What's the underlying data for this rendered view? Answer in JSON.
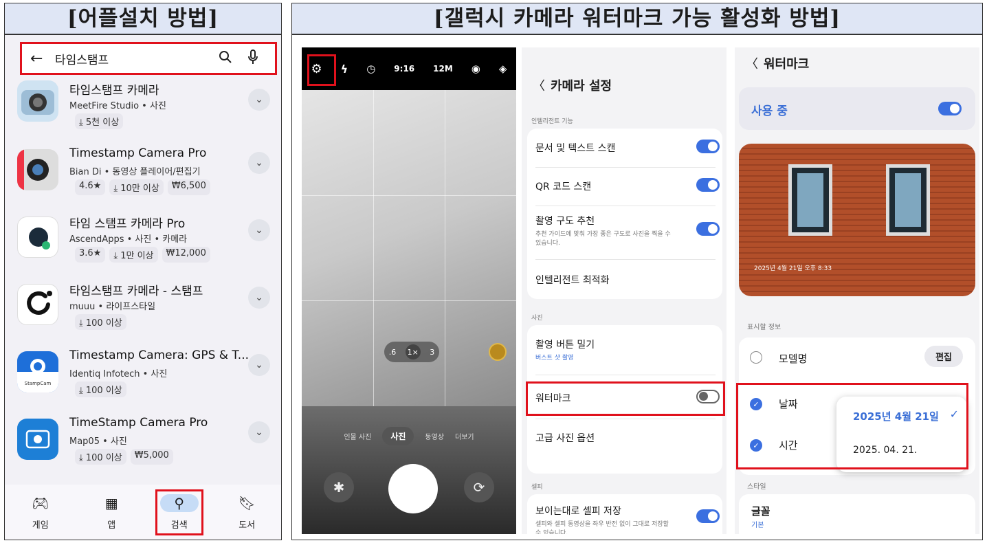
{
  "headers": {
    "left": "[어플설치 방법]",
    "right": "[갤럭시 카메라 워터마크 가능 활성화 방법]"
  },
  "store": {
    "search_query": "타임스탬프",
    "apps": [
      {
        "name": "타임스탬프 카메라",
        "dev": "MeetFire Studio • 사진",
        "badges": [
          "⤓ 5천 이상"
        ]
      },
      {
        "name": "Timestamp Camera Pro",
        "dev": "Bian Di • 동영상 플레이어/편집기",
        "badges": [
          "4.6★",
          "⤓ 10만 이상",
          "₩6,500"
        ]
      },
      {
        "name": "타임 스탬프 카메라 Pro",
        "dev": "AscendApps • 사진 • 카메라",
        "badges": [
          "3.6★",
          "⤓ 1만 이상",
          "₩12,000"
        ]
      },
      {
        "name": "타임스탬프 카메라 - 스탬프",
        "dev": "muuu • 라이프스타일",
        "badges": [
          "⤓ 100 이상"
        ]
      },
      {
        "name": "Timestamp Camera: GPS & T...",
        "dev": "Identiq Infotech • 사진",
        "badges": [
          "⤓ 100 이상"
        ]
      },
      {
        "name": "TimeStamp Camera Pro",
        "dev": "Map05 • 사진",
        "badges": [
          "⤓ 100 이상",
          "₩5,000"
        ]
      }
    ],
    "nav": [
      "게임",
      "앱",
      "검색",
      "도서"
    ],
    "stampcam_label": "StampCam"
  },
  "camera": {
    "topbar": [
      "9:16",
      "12M"
    ],
    "zoom": [
      ".6",
      "1×",
      "3"
    ],
    "modes": [
      "인물 사진",
      "사진",
      "동영상",
      "더보기"
    ]
  },
  "settings": {
    "title": "카메라 설정",
    "section1": "인텔리전트 기능",
    "doc_scan": "문서 및 텍스트 스캔",
    "qr_scan": "QR 코드 스캔",
    "composition": "촬영 구도 추천",
    "composition_sub": "추천 가이드에 맞춰 가장 좋은 구도로 사진을 찍을 수 있습니다.",
    "optimize": "인텔리전트 최적화",
    "section2": "사진",
    "swipe": "촬영 버튼 밀기",
    "swipe_sub": "버스트 샷 촬영",
    "watermark": "워터마크",
    "advanced": "고급 사진 옵션",
    "section3": "셀피",
    "selfie": "보이는대로 셀피 저장",
    "selfie_sub": "셀피와 셀피 동영상을 좌우 반전 없이 그대로 저장할 수 있습니다."
  },
  "watermark": {
    "title": "워터마크",
    "in_use": "사용 중",
    "stamp": "2025년 4월 21일 오후 8:33",
    "section_info": "표시할 정보",
    "model": "모델명",
    "edit": "편집",
    "date": "날짜",
    "time": "시간",
    "date_opt1": "2025년 4월 21일",
    "date_opt2": "2025. 04. 21.",
    "section_style": "스타일",
    "font": "글꼴",
    "font_sub": "기본"
  }
}
